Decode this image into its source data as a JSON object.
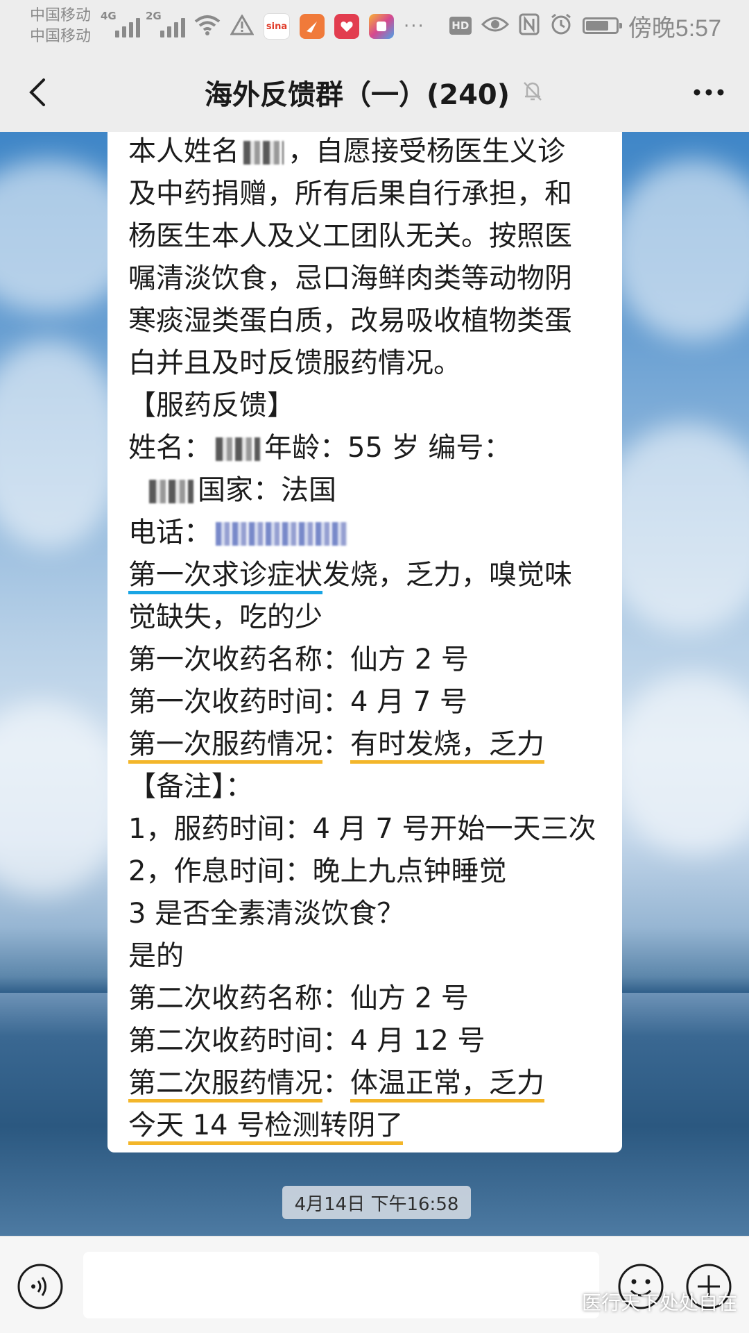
{
  "status_bar": {
    "carrier_1": "中国移动",
    "carrier_2": "中国移动",
    "network_1": "4G",
    "network_2": "2G",
    "hd_label": "HD",
    "time": "傍晚5:57",
    "battery_level": 0.75,
    "app_icons": [
      "sina-weibo-icon",
      "orange-app-icon",
      "red-app-icon",
      "pink-app-icon"
    ],
    "colors": {
      "sina": "#ffffff",
      "orange": "#f07a3a",
      "red": "#e23d4f",
      "pink": "#d6488f"
    }
  },
  "header": {
    "title": "海外反馈群（一）(240)"
  },
  "message": {
    "lines": [
      {
        "t": "本人姓名",
        "after_blur": "，自愿接受杨医生义诊"
      },
      {
        "t": "及中药捐赠，所有后果自行承担，和"
      },
      {
        "t": "杨医生本人及义工团队无关。按照医"
      },
      {
        "t": "嘱清淡饮食，忌口海鲜肉类等动物阴"
      },
      {
        "t": "寒痰湿类蛋白质，改易吸收植物类蛋"
      },
      {
        "t": "白并且及时反馈服药情况。"
      },
      {
        "t": "【服药反馈】"
      },
      {
        "t": "姓名：",
        "after_blur": "年龄：55 岁 编号："
      },
      {
        "t": "",
        "after_blur": "国家：法国"
      },
      {
        "t": "电话："
      },
      {
        "t_ul": "第一次求诊症状",
        "t_rest": "发烧，乏力，嗅觉味"
      },
      {
        "t": "觉缺失，吃的少"
      },
      {
        "t": "第一次收药名称：仙方 2 号"
      },
      {
        "t": "第一次收药时间：4 月 7 号"
      },
      {
        "t_ul": "第一次服药情况",
        "t_mid": "：",
        "t_ul2": "有时发烧，乏力"
      },
      {
        "t": "【备注】："
      },
      {
        "t": "1，服药时间：4 月 7 号开始一天三次"
      },
      {
        "t": "2，作息时间：晚上九点钟睡觉"
      },
      {
        "t": "3 是否全素清淡饮食？"
      },
      {
        "t": "  是的"
      },
      {
        "t": "第二次收药名称：仙方 2 号"
      },
      {
        "t": "第二次收药时间：4 月 12 号"
      },
      {
        "t_ul": "第二次服药情况",
        "t_mid": "：",
        "t_ul2": "体温正常，乏力"
      },
      {
        "t_ul": "今天 14 号检测转阴了"
      }
    ]
  },
  "timestamp": "4月14日 下午16:58",
  "input": {
    "value": "",
    "placeholder": ""
  },
  "watermark": "医行天下处处自在",
  "colors": {
    "underline_blue": "#19a5e4",
    "underline_yellow": "#f3b62a"
  }
}
